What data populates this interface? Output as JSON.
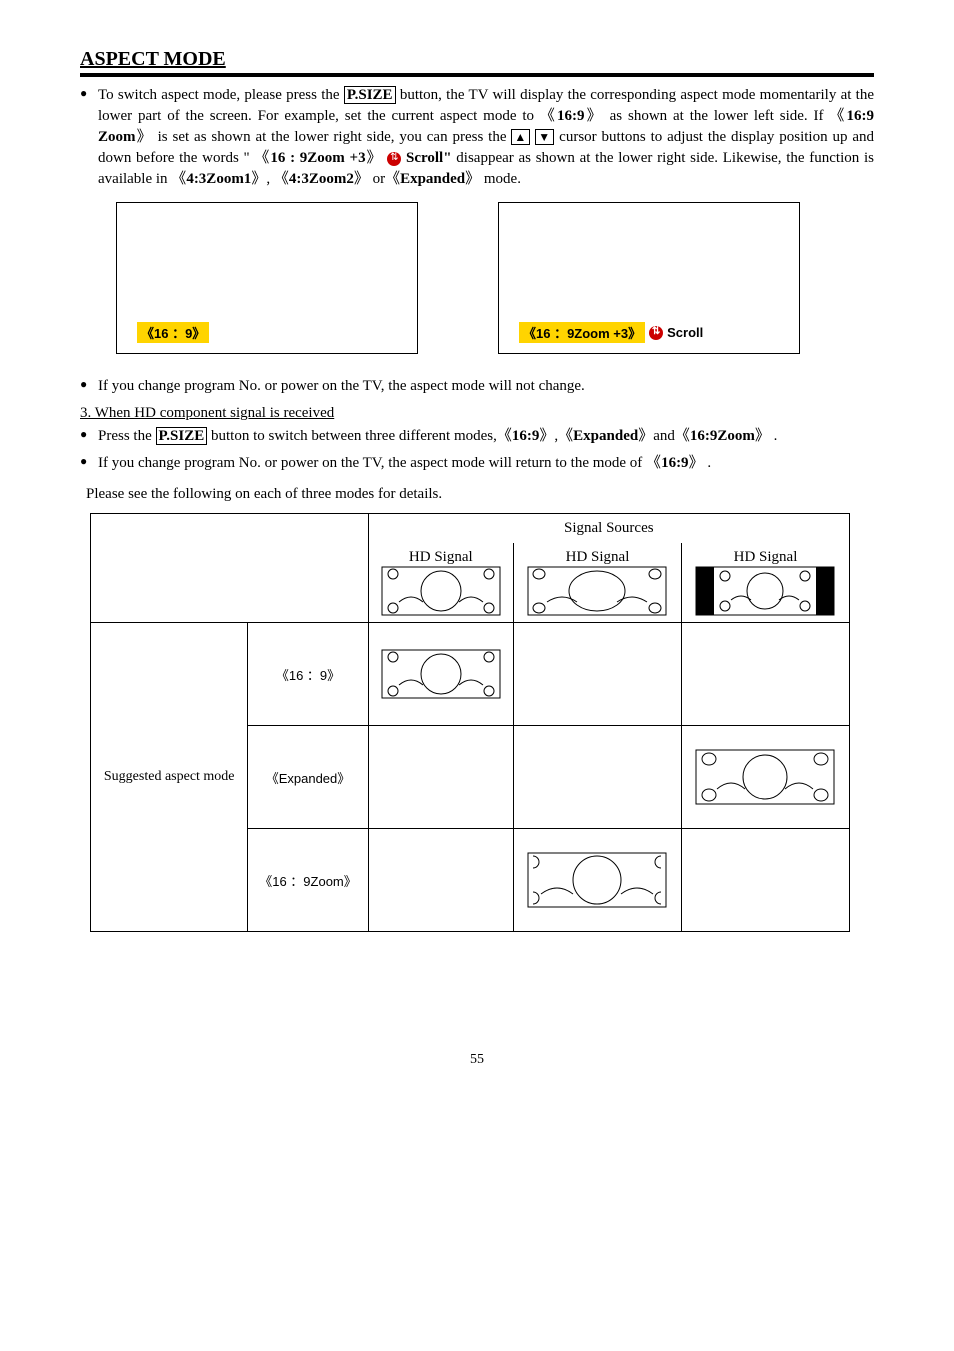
{
  "title": "ASPECT MODE",
  "para1_a": "To switch aspect mode, please press the ",
  "psize": "P.SIZE",
  "para1_b": " button, the TV will display the corresponding aspect mode momentarily at the lower part of the screen. For example, set the current aspect mode to  《",
  "m169": "16:9",
  "para1_c": "》  as shown at the lower left side. If  《",
  "m169zoom": "16:9 Zoom",
  "para1_d": "》  is set as shown at the lower right side, you can press the ",
  "up": "▲",
  "down": "▼",
  "para1_e": " cursor buttons to adjust the display position up and down before the words  \" 《",
  "scroll_label": "16 : 9Zoom   +3",
  "para1_f": "》 ",
  "scroll_word": "Scroll\"",
  "para1_g": " disappear as shown at the lower right side. Likewise, the function is available in 《",
  "m43z1": "4:3Zoom1",
  "para1_h": "》, 《",
  "m43z2": "4:3Zoom2",
  "para1_i": "》 or《",
  "mexp": "Expanded",
  "para1_j": "》 mode.",
  "tv1_label": "《16 ：9》",
  "tv2_label": "《16 ：9Zoom +3》",
  "tv2_scroll": "Scroll",
  "bullet2": "If you change program No. or power on the TV, the aspect mode will not change.",
  "sec3": "3. When HD component signal is received",
  "b3a_a": "Press the ",
  "b3a_b": " button to switch between three different modes,《",
  "b3a_c": "》,《",
  "b3a_d": "》and《",
  "m169z2": "16:9Zoom",
  "b3a_e": "》 .",
  "b3b_a": "If you change program No. or power on the TV, the aspect mode will return to the mode of   《",
  "b3b_b": "》 .",
  "note": "Please see the following on each of three modes for details.",
  "table": {
    "sig_sources": "Signal Sources",
    "hd_signal": "HD Signal",
    "suggested": "Suggested aspect mode",
    "row1": "《16 ：9》",
    "row2": "《Expanded》",
    "row3": "《16 ：9Zoom》"
  },
  "pagenum": "55"
}
